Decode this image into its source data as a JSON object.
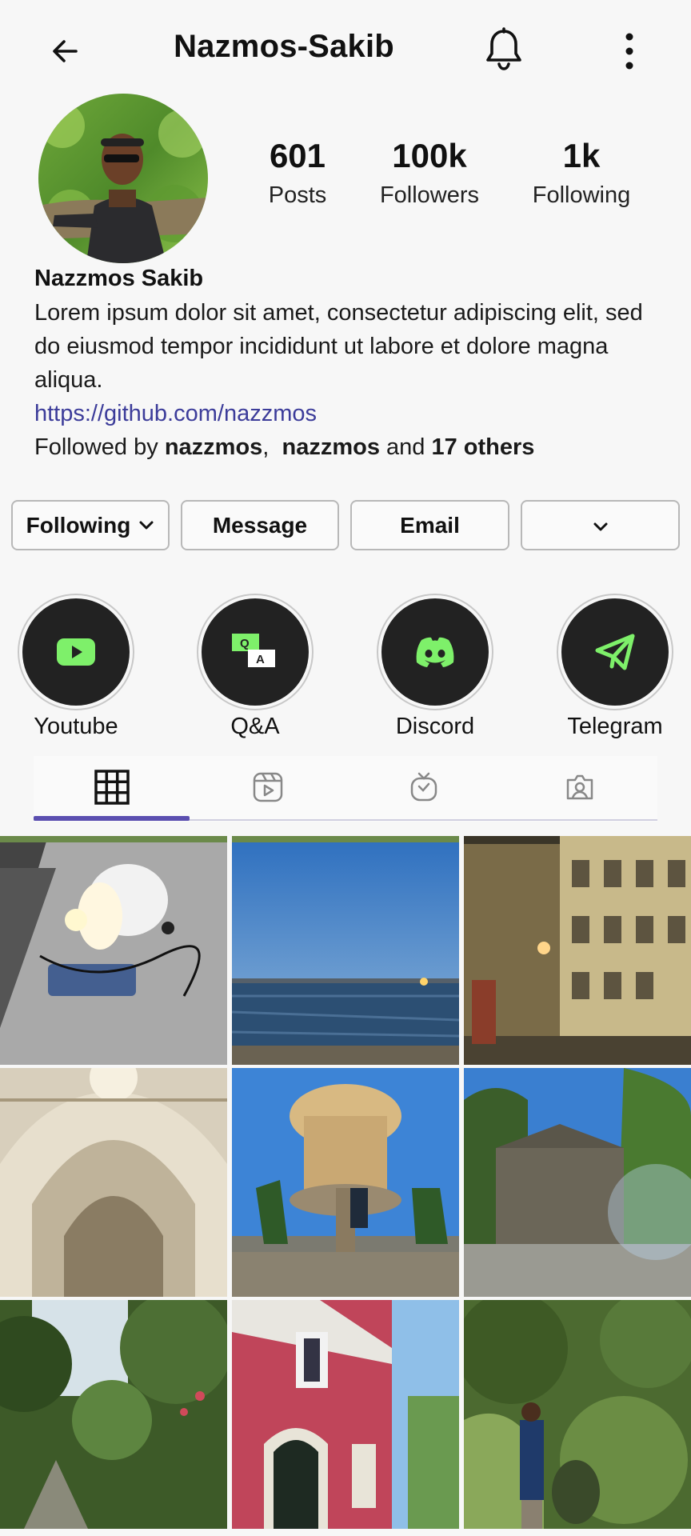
{
  "header": {
    "title": "Nazmos-Sakib",
    "back_icon": "arrow-left-icon",
    "bell_icon": "bell-icon",
    "more_icon": "more-vertical-icon"
  },
  "stats": {
    "posts_value": "601",
    "posts_label": "Posts",
    "followers_value": "100k",
    "followers_label": "Followers",
    "following_value": "1k",
    "following_label": "Following"
  },
  "bio": {
    "name": "Nazzmos Sakib",
    "description": "Lorem ipsum dolor sit amet, consectetur adipiscing elit, sed do eiusmod tempor incididunt ut labore et dolore magna aliqua.",
    "link": "https://github.com/nazzmos",
    "followed_by_prefix": "Followed by",
    "followed_by_user1": "nazzmos",
    "followed_by_sep": ",",
    "followed_by_user2": "nazzmos",
    "followed_by_and": "and",
    "followed_by_others": "17 others"
  },
  "actions": {
    "following_label": "Following",
    "message_label": "Message",
    "email_label": "Email"
  },
  "highlights": [
    {
      "label": "Youtube",
      "icon": "youtube-icon"
    },
    {
      "label": "Q&A",
      "icon": "qa-icon"
    },
    {
      "label": "Discord",
      "icon": "discord-icon"
    },
    {
      "label": "Telegram",
      "icon": "telegram-icon"
    }
  ],
  "tabs": [
    {
      "icon": "grid-icon",
      "active": true
    },
    {
      "icon": "reels-icon",
      "active": false
    },
    {
      "icon": "igtv-icon",
      "active": false
    },
    {
      "icon": "tagged-icon",
      "active": false
    }
  ],
  "colors": {
    "accent": "#5b4fb0",
    "link": "#3c3c9a",
    "highlight_icon": "#7ef06a",
    "highlight_bg": "#222222"
  }
}
